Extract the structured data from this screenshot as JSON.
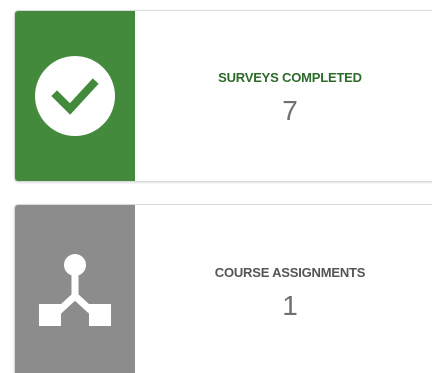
{
  "cards": [
    {
      "label": "SURVEYS COMPLETED",
      "value": "7",
      "icon": "checkmark-circle-icon",
      "panel_color": "#438a3d",
      "label_color": "#2d6b2a"
    },
    {
      "label": "COURSE ASSIGNMENTS",
      "value": "1",
      "icon": "branching-path-icon",
      "panel_color": "#8c8c8c",
      "label_color": "#555555"
    }
  ]
}
